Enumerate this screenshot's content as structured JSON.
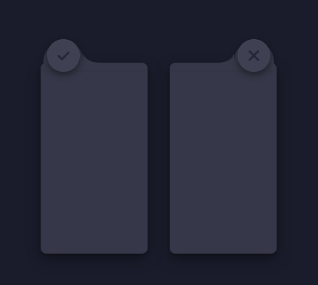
{
  "colors": {
    "background": "#1a1c2b",
    "card": "#363849",
    "button": "#3f4153",
    "icon": "#24263a"
  },
  "cards": [
    {
      "id": "left",
      "action_icon": "check-icon"
    },
    {
      "id": "right",
      "action_icon": "close-icon"
    }
  ]
}
